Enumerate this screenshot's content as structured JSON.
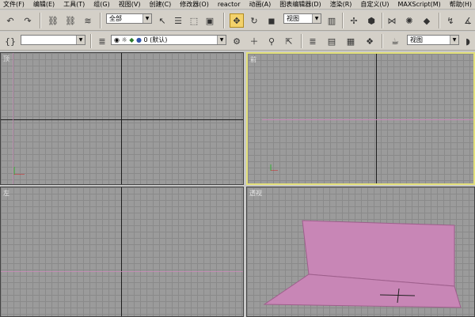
{
  "menu": [
    "文件(F)",
    "编辑(E)",
    "工具(T)",
    "组(G)",
    "视图(V)",
    "创建(C)",
    "修改器(O)",
    "reactor",
    "动画(A)",
    "图表编辑器(D)",
    "渲染(R)",
    "自定义(U)",
    "MAXScript(M)",
    "帮助(H)"
  ],
  "toolbar1": {
    "selection_filter": "全部",
    "coord_system": "视图"
  },
  "toolbar2": {
    "layer_name": "0 (默认)",
    "named_selection": "视图"
  },
  "viewports": {
    "top_label": "顶",
    "front_label": "前",
    "left_label": "左",
    "persp_label": "透视"
  },
  "colors": {
    "active_border": "#e3e07a",
    "object_fill": "#c886b6",
    "viewport_bg": "#9b9b9b"
  }
}
